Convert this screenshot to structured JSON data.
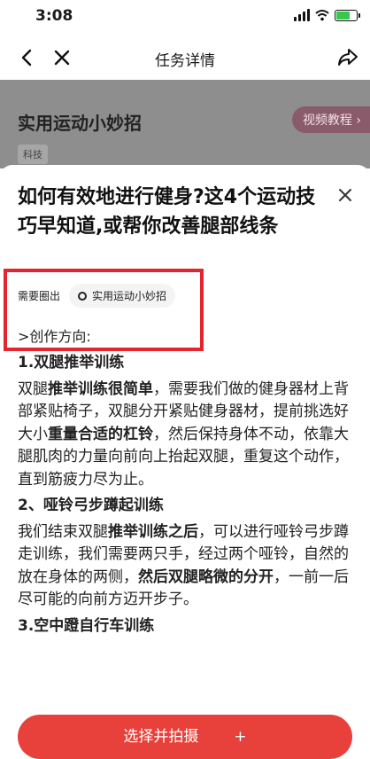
{
  "status_bar": {
    "time": "3:08"
  },
  "nav": {
    "title": "任务详情"
  },
  "banner": {
    "title": "实用运动小妙招",
    "tag": "科技",
    "button": "视频教程 ›"
  },
  "task": {
    "title": "如何有效地进行健身?这4个运动技巧早知道,或帮你改善腿部线条",
    "meta_label": "需要圈出",
    "chip_label": "实用运动小妙招",
    "direction": ">创作方向:"
  },
  "content": {
    "h1": "1.双腿",
    "h1_b": "推举训练",
    "p1_a": "双腿",
    "p1_b": "推举训练很简单",
    "p1_c": "，需要我们做的健身器材上背部紧贴椅子，双腿分开紧贴健身器材，提前挑选好大小",
    "p1_d": "重量合适的杠铃",
    "p1_e": "，然后保持身体不动，依靠大腿肌肉的力量向前向上抬起双腿，重复这个动作，直到筋疲力尽为止。",
    "h2": "2、哑铃弓步蹲起训练",
    "p2_a": "我们结束双腿",
    "p2_b": "推举训练之后",
    "p2_c": "，可以进行哑铃弓步蹲走训练，我们需要两只手，经过两个哑铃，自然的放在身体的两侧，",
    "p2_d": "然后双腿略微的分开",
    "p2_e": "，一前一后尽可能的向前方迈开步子。",
    "h3": "3.空中蹬自行车训练"
  },
  "bottom": {
    "button": "选择并拍摄",
    "plus": "+"
  },
  "colors": {
    "accent": "#e8403a",
    "highlight": "#e3262e"
  },
  "icons": [
    "back-icon",
    "close-icon",
    "share-icon",
    "signal-icon",
    "wifi-icon",
    "battery-icon"
  ]
}
